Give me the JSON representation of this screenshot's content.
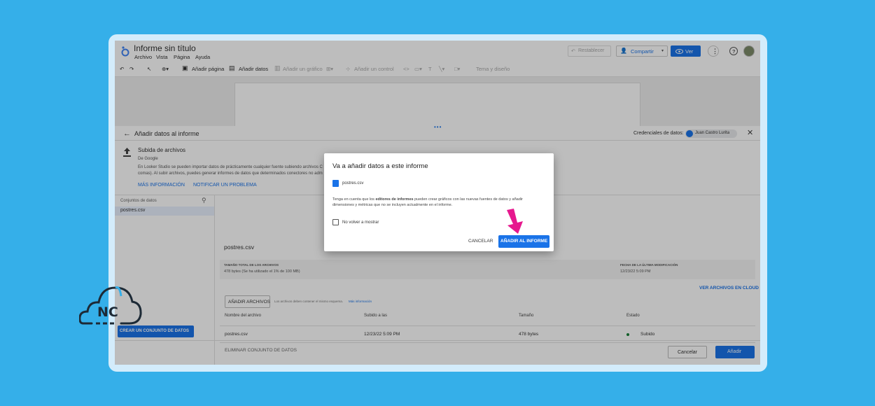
{
  "app": {
    "title": "Informe sin título",
    "menus": [
      "Archivo",
      "Vista",
      "Página",
      "Ayuda"
    ],
    "restore_label": "Restablecer",
    "share_label": "Compartir",
    "view_label": "Ver"
  },
  "toolbar": {
    "add_page": "Añadir página",
    "add_data": "Añadir datos",
    "add_chart": "Añadir un gráfico",
    "add_control": "Añadir un control",
    "theme": "Tema y diseño"
  },
  "panel": {
    "title": "Añadir datos al informe",
    "credentials_label": "Credenciales de datos:",
    "credentials_user": "Juan Castro Lurita",
    "connector_title": "Subida de archivos",
    "connector_by": "De Google",
    "connector_desc_1": "En Looker Studio se pueden importar datos de prácticamente cualquier fuente subiendo archivos C",
    "connector_desc_2": "comas). Al subir archivos, puedes generar informes de datos que determinados conectores no adm",
    "more_info": "MÁS INFORMACIÓN",
    "report_problem": "NOTIFICAR UN PROBLEMA",
    "datasets_label": "Conjuntos de datos",
    "dataset_item": "postres.csv",
    "create_dataset": "CREAR UN CONJUNTO DE DATOS",
    "file_heading": "postres.csv",
    "total_size_label": "TAMAÑO TOTAL DE LOS ARCHIVOS",
    "total_size_value": "478 bytes (Se ha utilizado el 1% de 100 MB)",
    "modified_label": "FECHA DE LA ÚLTIMA MODIFICACIÓN",
    "modified_value": "12/23/22 5:09 PM",
    "view_cloud": "VER ARCHIVOS EN CLOUD",
    "add_files": "AÑADIR ARCHIVOS",
    "add_files_note": "Los archivos deben contener el mismo esquema.",
    "add_files_link": "Más información",
    "columns": [
      "Nombre del archivo",
      "Subido a las",
      "Tamaño",
      "Estado"
    ],
    "row": {
      "name": "postres.csv",
      "uploaded": "12/23/22 5:09 PM",
      "size": "478 bytes",
      "status": "Subido"
    },
    "delete_dataset": "ELIMINAR CONJUNTO DE DATOS",
    "cancel": "Cancelar",
    "add": "Añadir"
  },
  "dialog": {
    "title": "Va a añadir datos a este informe",
    "file": "postres.csv",
    "text_1a": "Tenga en cuenta que los ",
    "text_1b": "editores de informes",
    "text_1c": " pueden crear gráficos con las nuevas fuentes de datos y añadir",
    "text_2": "dimensiones y métricas que no se incluyen actualmente en el informe.",
    "checkbox_label": "No volver a mostrar",
    "cancel": "CANCELAR",
    "confirm": "AÑADIR AL INFORME"
  },
  "logo": {
    "text": "NC"
  },
  "colors": {
    "accent": "#1a73e8",
    "background": "#35afe9",
    "arrow": "#e6188e",
    "status": "#188038"
  }
}
